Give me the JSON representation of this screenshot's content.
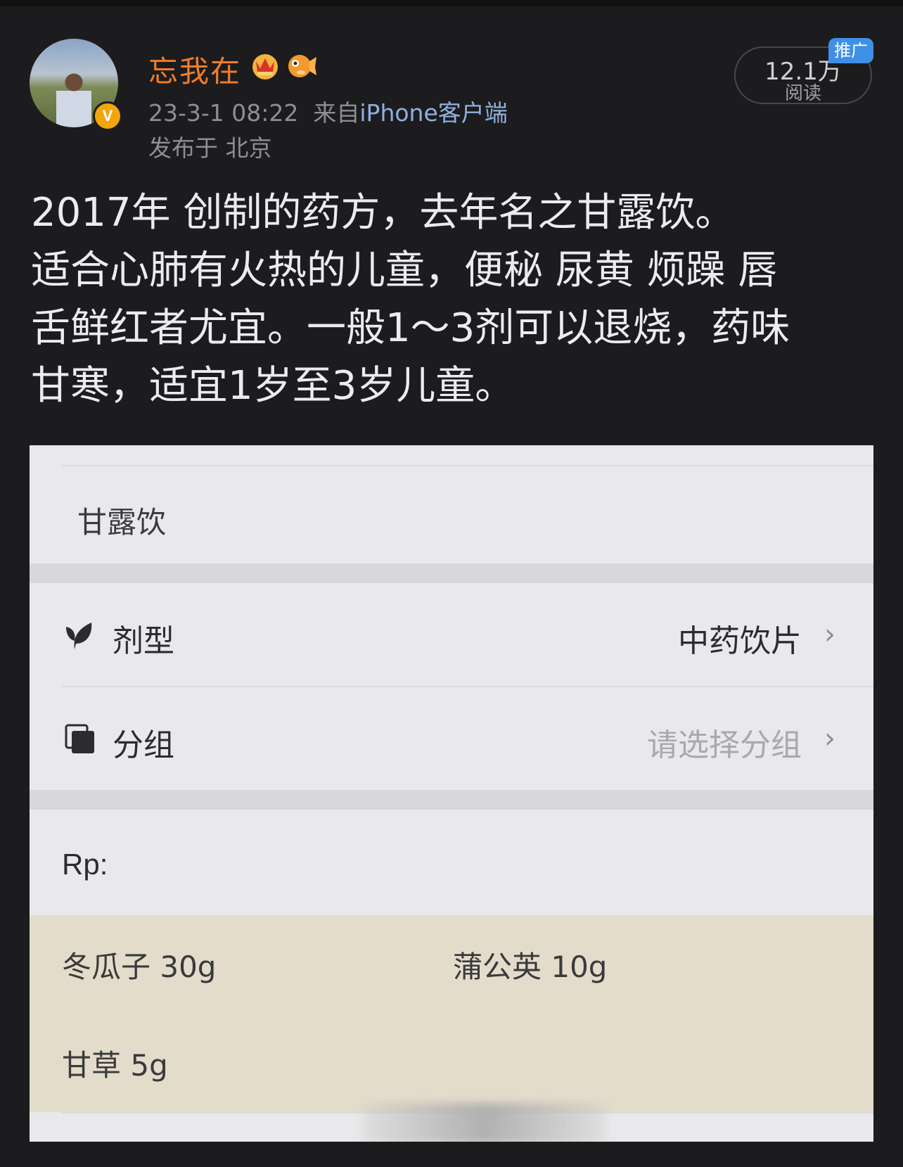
{
  "post": {
    "author": {
      "name": "忘我在",
      "verified_badge": "V"
    },
    "time": "23-3-1 08:22",
    "source_prefix": "来自",
    "source": "iPhone客户端",
    "location": "发布于 北京",
    "reads": {
      "count": "12.1万",
      "label": "阅读"
    },
    "promo_tag": "推广",
    "text_lines": [
      "2017年 创制的药方，去年名之甘露饮。",
      "适合心肺有火热的儿童，便秘 尿黄 烦躁 唇",
      "舌鲜红者尤宜。一般1～3剂可以退烧，药味",
      "甘寒，适宜1岁至3岁儿童。"
    ]
  },
  "prescription": {
    "name": "甘露饮",
    "dosage_form": {
      "label": "剂型",
      "value": "中药饮片",
      "icon": "leaf-icon"
    },
    "group": {
      "label": "分组",
      "placeholder": "请选择分组",
      "icon": "stack-icon"
    },
    "rp_label": "Rp:",
    "herbs": [
      "冬瓜子 30g",
      "蒲公英 10g",
      "甘草 5g"
    ]
  },
  "colors": {
    "background": "#1c1c1e",
    "username": "#f07d2a",
    "source_link": "#8fb1de",
    "promo": "#3f8fe6",
    "verified": "#f2a50c",
    "card": "#e9e9eb",
    "herb_panel": "#e4dccb"
  }
}
